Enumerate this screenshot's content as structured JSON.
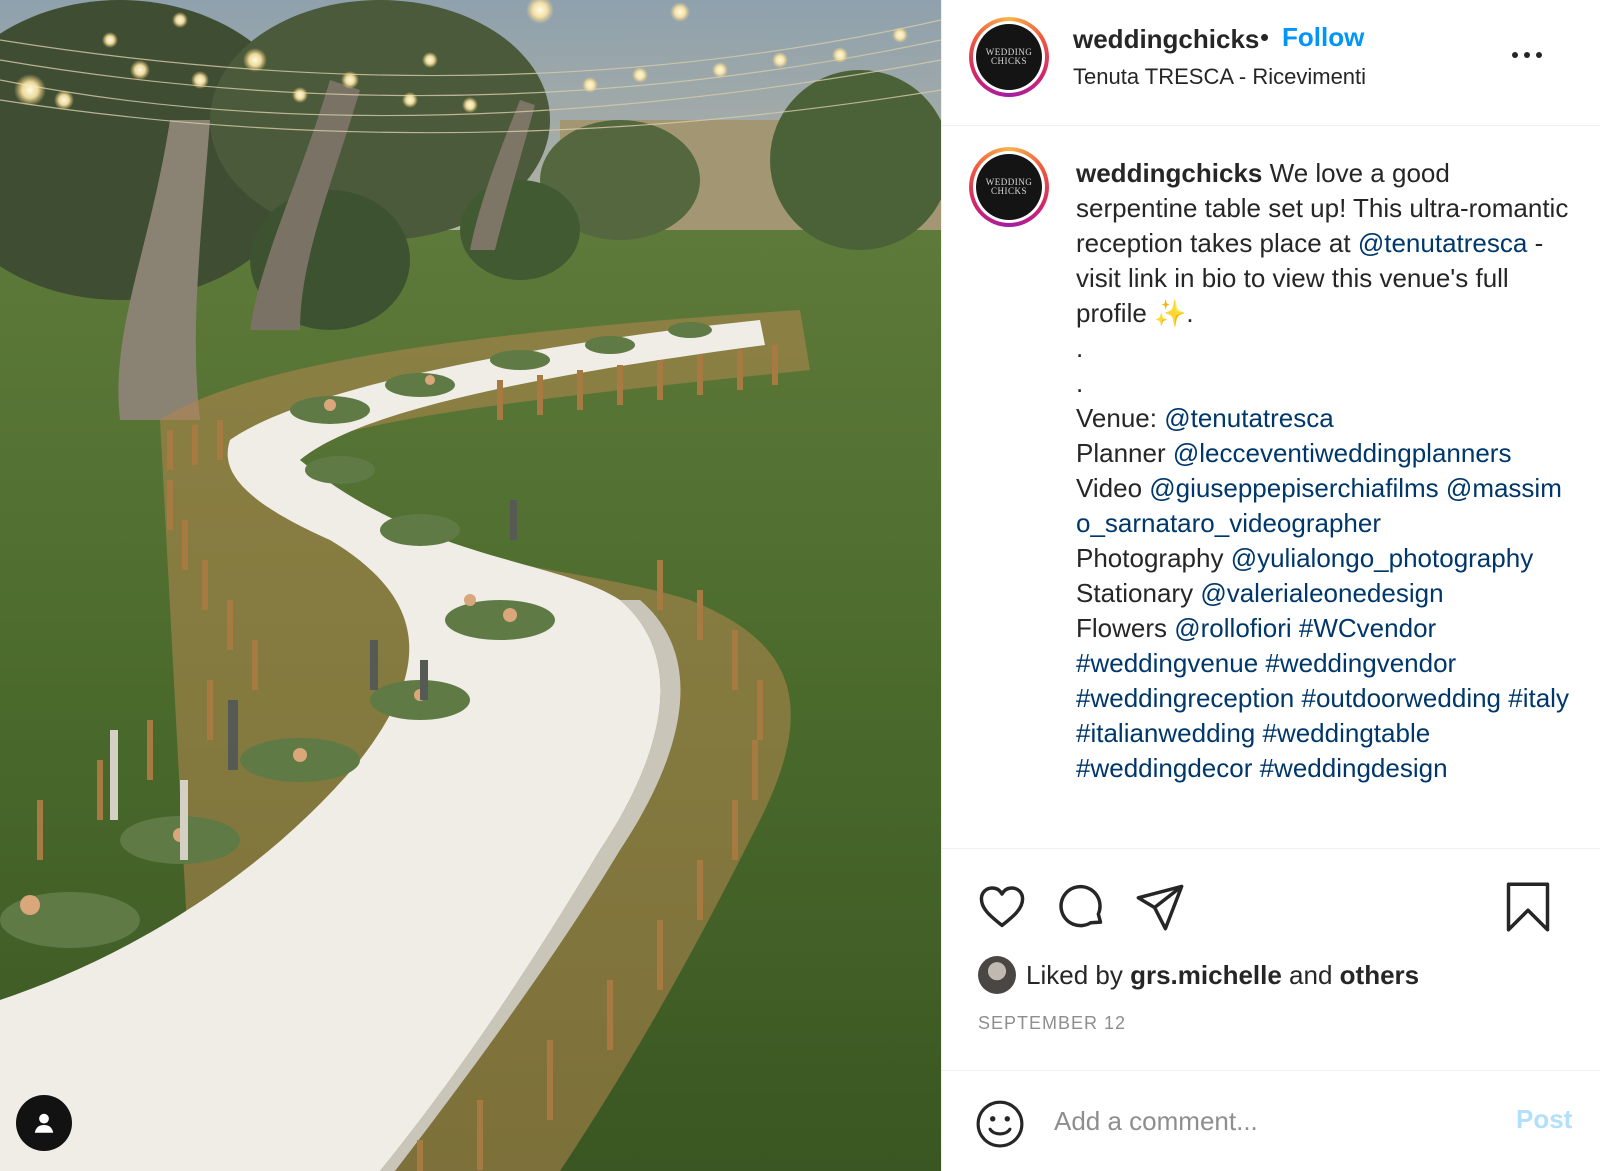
{
  "post": {
    "image_alt": "Serpentine wedding reception table under string lights in an olive grove",
    "tag_icon": "user-tag-icon"
  },
  "header": {
    "username": "weddingchicks",
    "separator": "•",
    "follow_label": "Follow",
    "location": "Tenuta TRESCA - Ricevimenti",
    "more_icon": "more-options-icon",
    "avatar_text_top": "WEDDING",
    "avatar_text_bottom": "CHICKS"
  },
  "caption": {
    "username": "weddingchicks",
    "intro_before_mention": "We love a good serpentine table set up! This ultra-romantic reception takes place at",
    "intro_mention": "@tenutatresca",
    "intro_after_mention": "- visit link in bio to view this venue's full profile ✨.",
    "dot1": ".",
    "dot2": ".",
    "credits": [
      {
        "label": "Venue:",
        "mentions": [
          "@tenutatresca"
        ]
      },
      {
        "label": "Planner",
        "mentions": [
          "@lecceventiweddingplanners"
        ]
      },
      {
        "label": "Video",
        "mentions": [
          "@giuseppepiserchiafilms",
          "@massimo_sarnataro_videographer"
        ]
      },
      {
        "label": "Photography",
        "mentions": [
          "@yulialongo_photography"
        ]
      },
      {
        "label": "Stationary",
        "mentions": [
          "@valerialeonedesign"
        ]
      },
      {
        "label": "Flowers",
        "mentions": [
          "@rollofiori",
          "#WCvendor"
        ]
      }
    ],
    "hashtags": [
      "#weddingvenue",
      "#weddingvendor",
      "#weddingreception",
      "#outdoorwedding",
      "#italy",
      "#italianwedding",
      "#weddingtable",
      "#weddingdecor",
      "#weddingdesign"
    ]
  },
  "actions": {
    "like_icon": "heart-icon",
    "comment_icon": "comment-bubble-icon",
    "share_icon": "paper-plane-icon",
    "save_icon": "bookmark-icon"
  },
  "likes": {
    "prefix": "Liked by",
    "user": "grs.michelle",
    "conjunction": "and",
    "others": "others"
  },
  "date": "SEPTEMBER 12",
  "comment": {
    "placeholder": "Add a comment...",
    "post_label": "Post",
    "emoji_icon": "smiley-icon"
  },
  "colors": {
    "link_blue": "#0095f6",
    "mention_navy": "#00376b",
    "post_disabled": "#b2dffc",
    "muted": "#8e8e8e"
  }
}
